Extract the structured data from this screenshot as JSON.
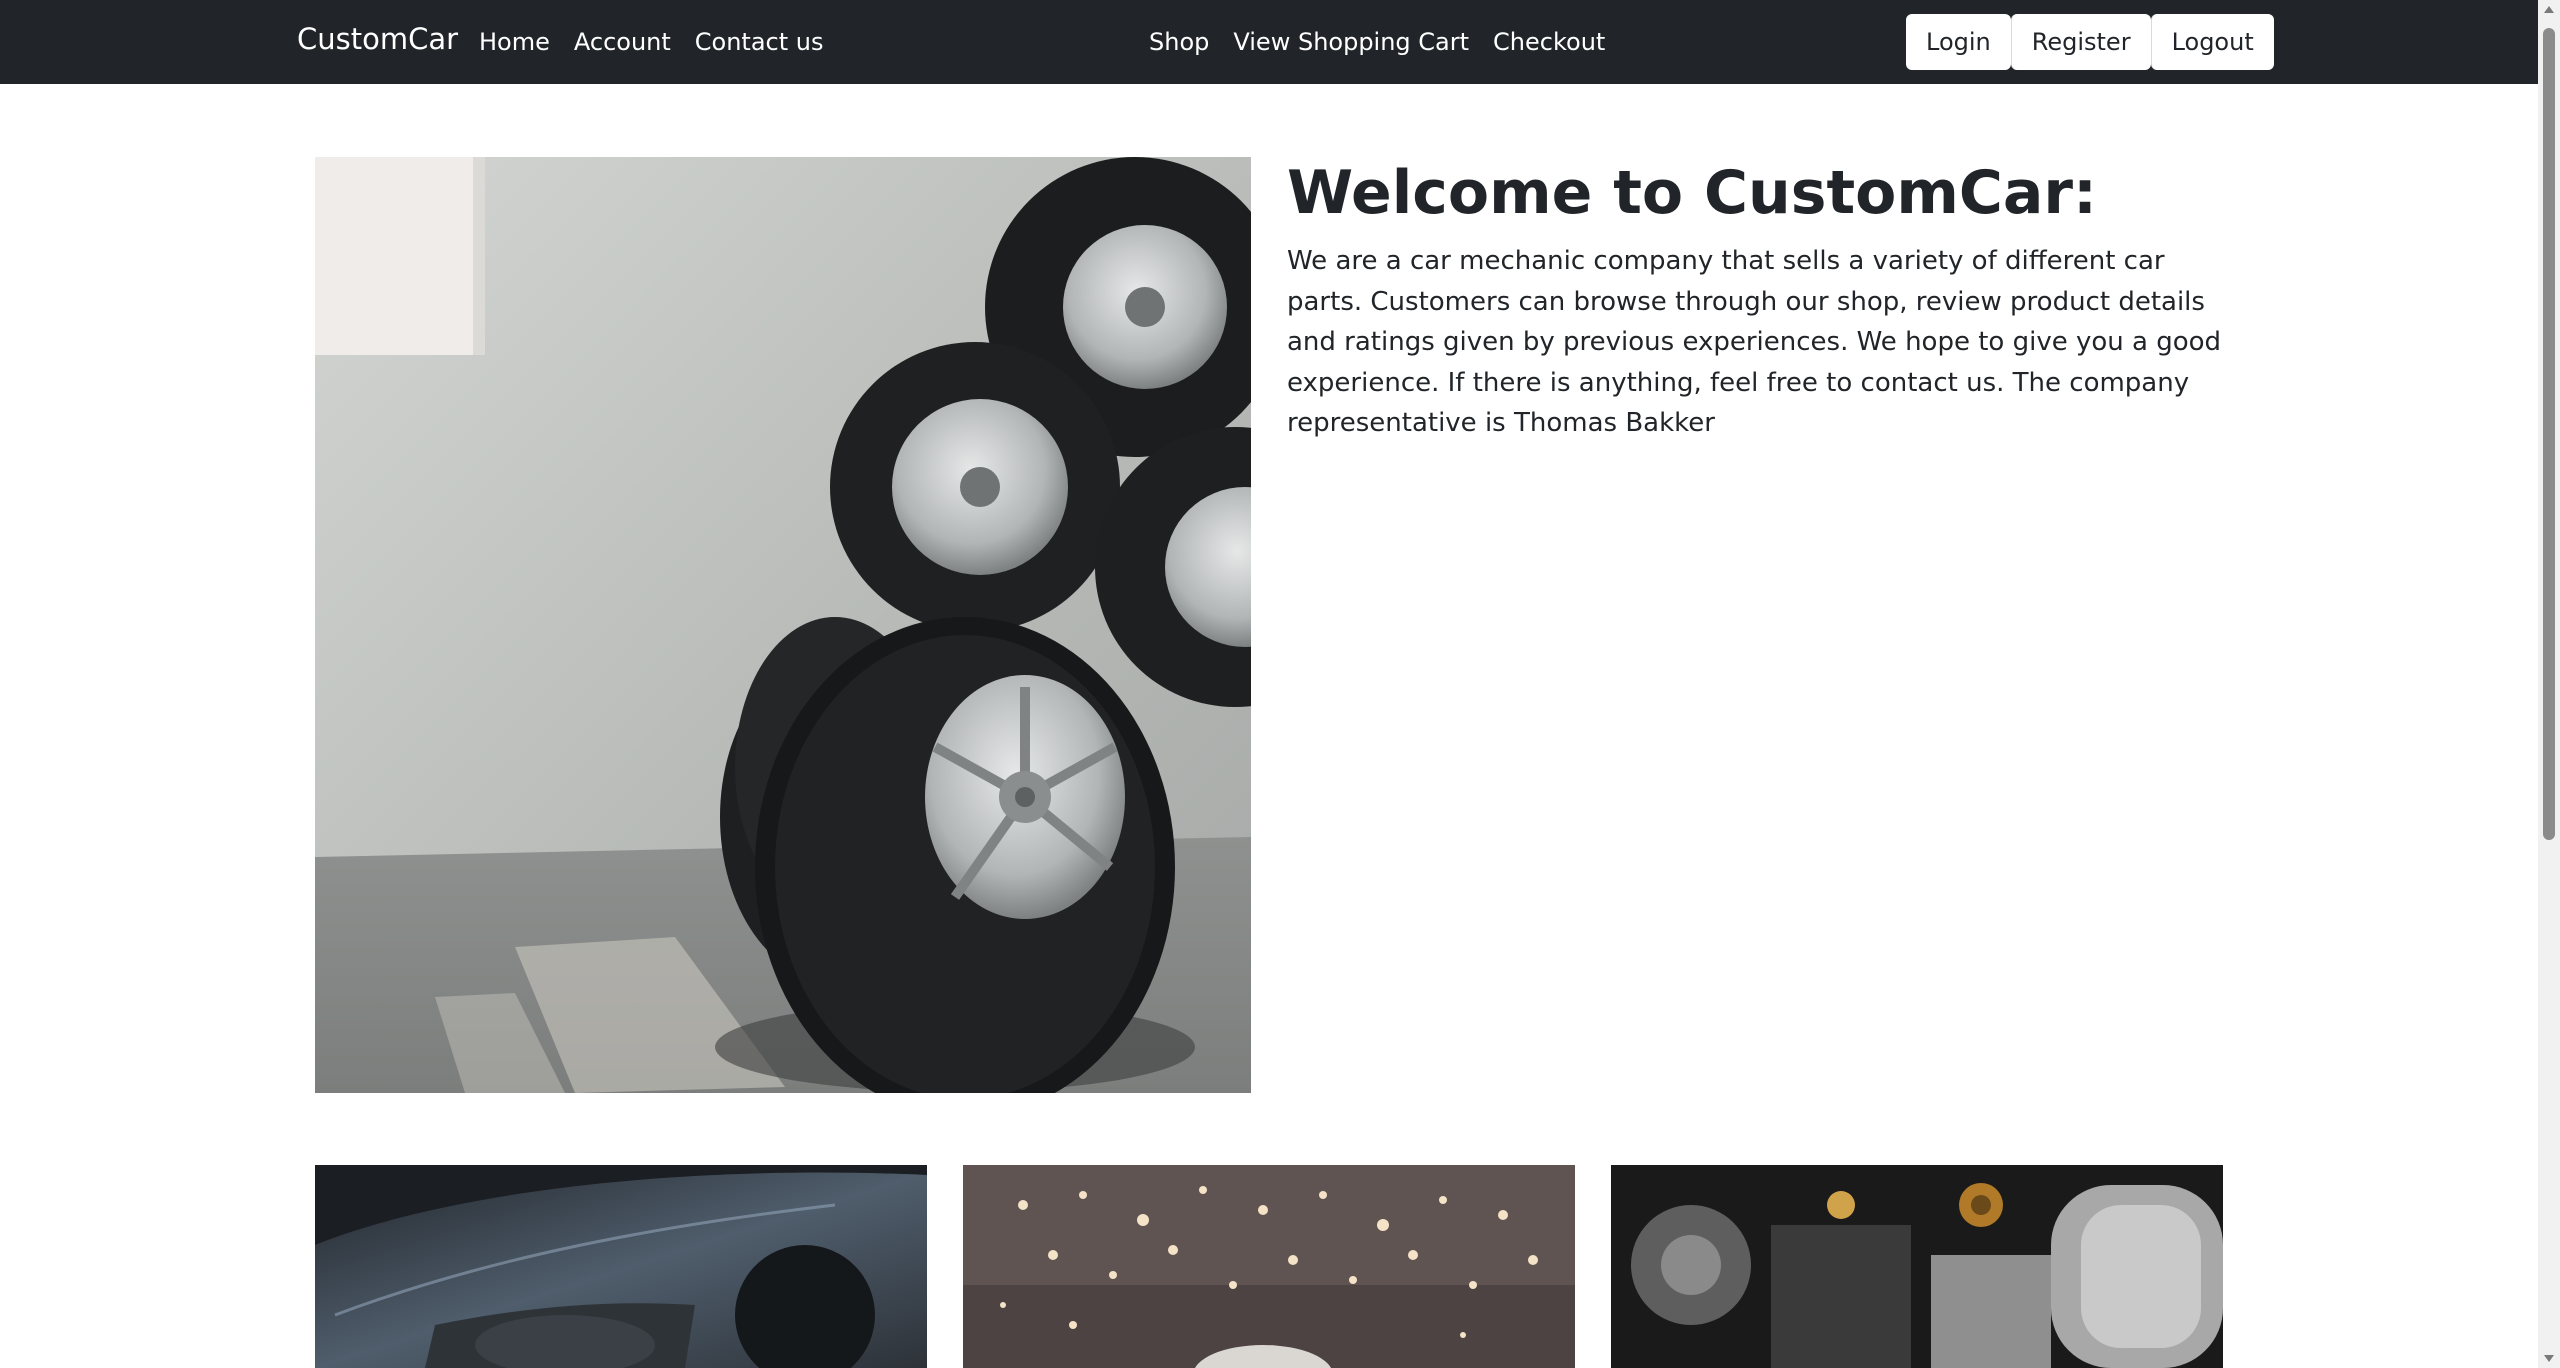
{
  "navbar": {
    "brand": "CustomCar",
    "left_links": [
      "Home",
      "Account",
      "Contact us"
    ],
    "center_links": [
      "Shop",
      "View Shopping Cart",
      "Checkout"
    ],
    "buttons": [
      "Login",
      "Register",
      "Logout"
    ]
  },
  "hero": {
    "title": "Welcome to CustomCar:",
    "text": "We are a car mechanic company that sells a variety of different car parts. Customers can browse through our shop, review product details and ratings given by previous experiences. We hope to give you a good experience. If there is anything, feel free to contact us. The company representative is Thomas Bakker"
  },
  "colors": {
    "navbar_bg": "#212529",
    "nav_text": "#ffffff",
    "body_text": "#212529",
    "button_bg": "#ffffff"
  }
}
